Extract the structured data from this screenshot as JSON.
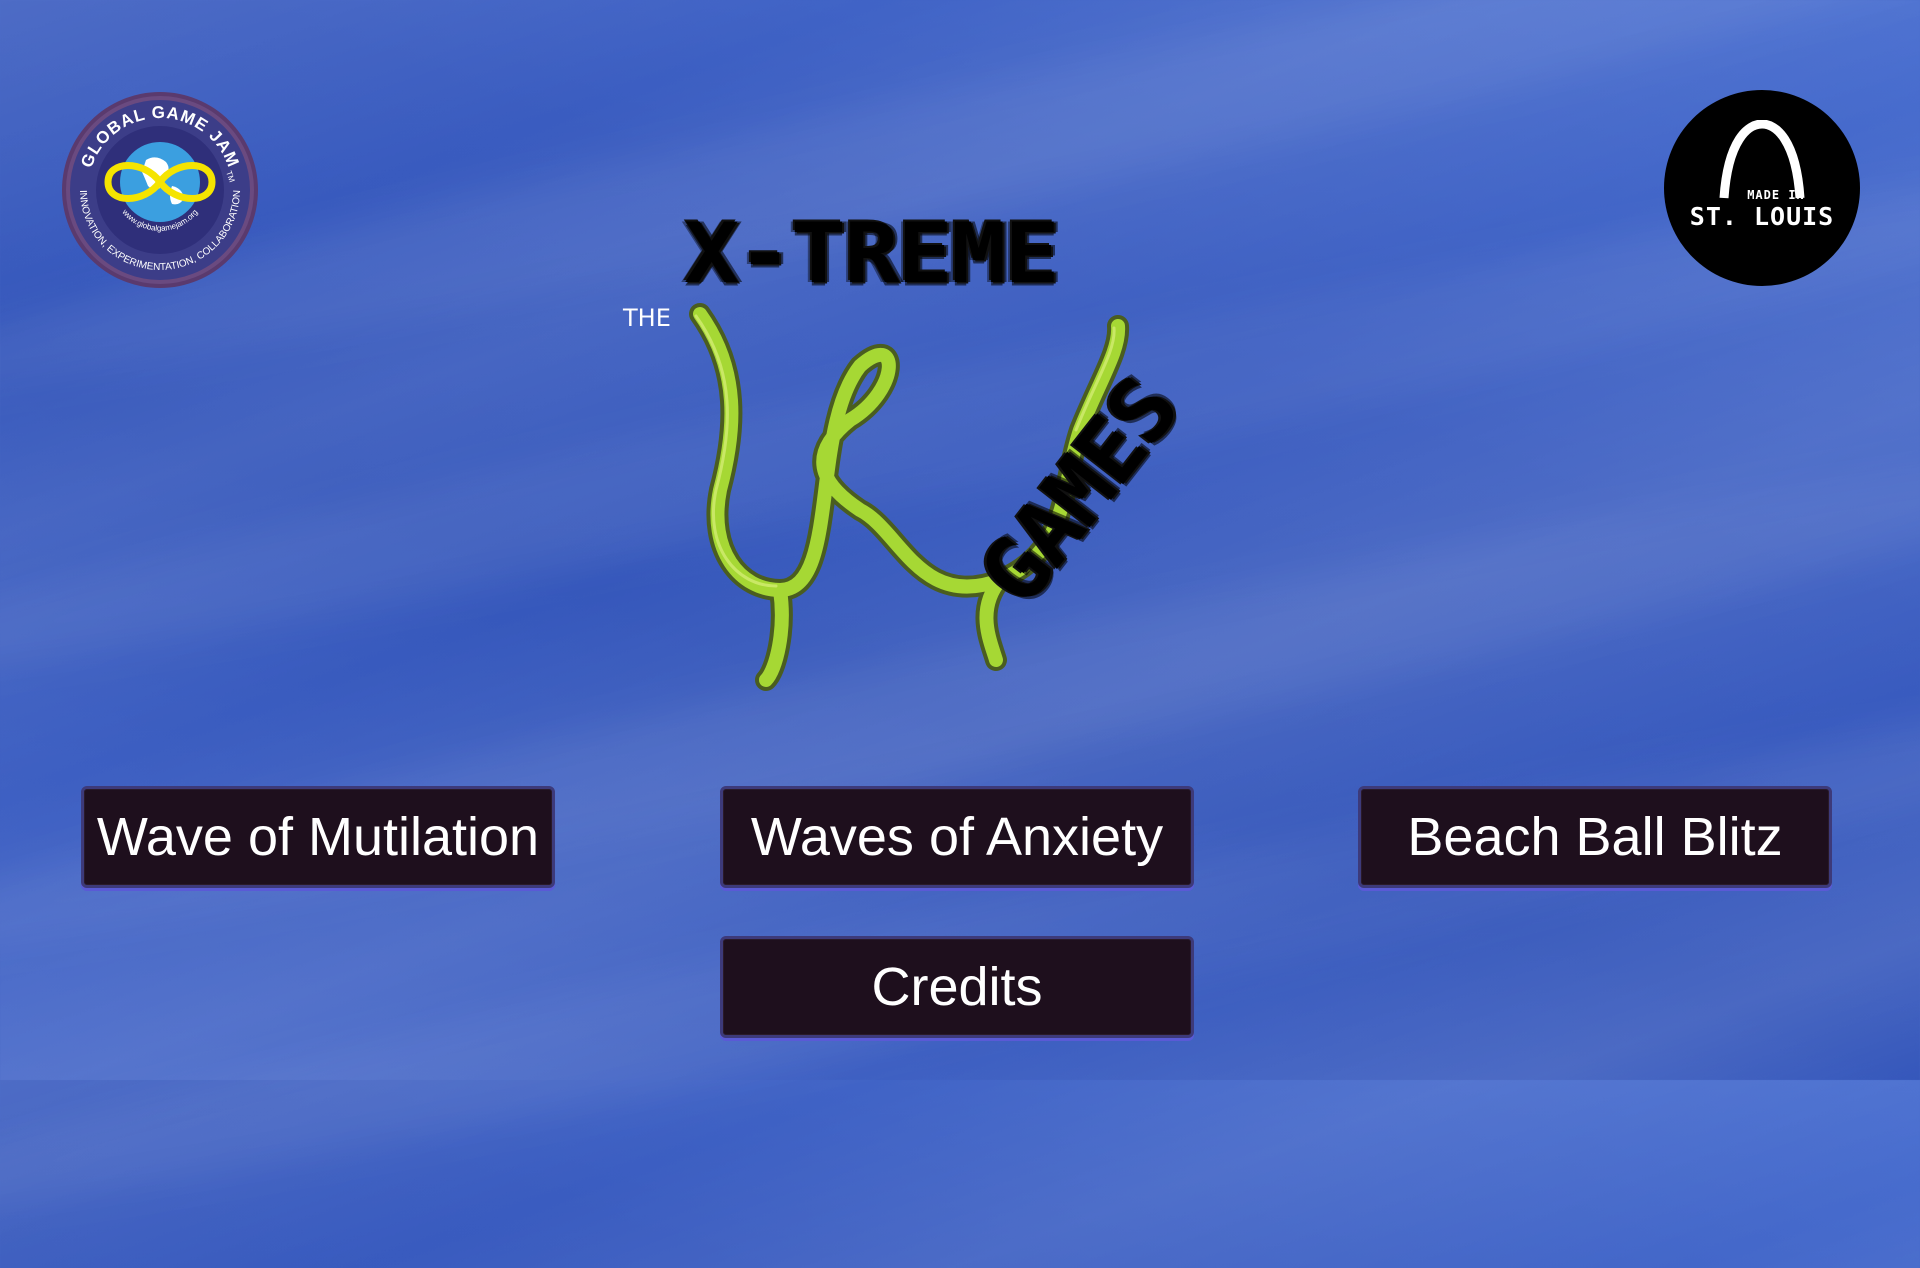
{
  "badges": {
    "ggj": {
      "title": "GLOBAL GAME JAM",
      "tm": "TM",
      "url": "www.globalgamejam.org",
      "tagline": "INNOVATION, EXPERIMENTATION, COLLABORATION"
    },
    "stl": {
      "made_in": "MADE IN",
      "city": "ST. LOUIS"
    }
  },
  "logo": {
    "the": "THE",
    "xtreme": "X-TREME",
    "games": "GAMES",
    "w_color": "#a6d834"
  },
  "menu": {
    "buttons": [
      {
        "label": "Wave of Mutilation"
      },
      {
        "label": "Waves of Anxiety"
      },
      {
        "label": "Beach Ball Blitz"
      },
      {
        "label": "Credits"
      }
    ]
  }
}
